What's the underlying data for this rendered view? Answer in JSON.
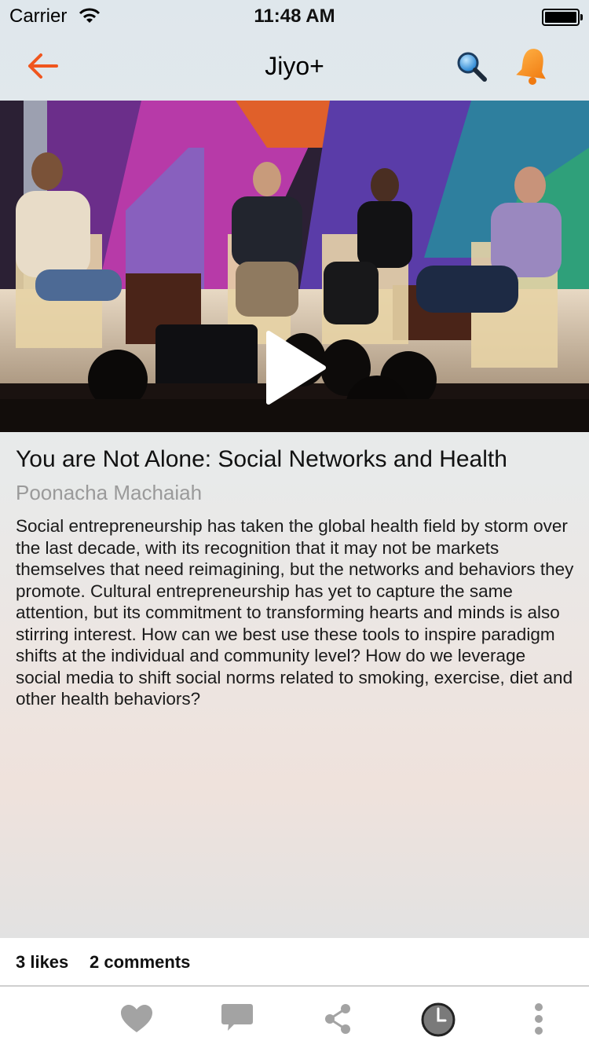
{
  "status_bar": {
    "carrier": "Carrier",
    "time": "11:48 AM"
  },
  "nav": {
    "title": "Jiyo+",
    "accent_color": "#f0561e"
  },
  "video": {
    "has_play_button": true
  },
  "article": {
    "title": "You are Not Alone: Social Networks and Health",
    "author": "Poonacha Machaiah",
    "description": "Social entrepreneurship has taken the global health field by storm over the last decade, with its recognition that it may not be markets themselves that need reimagining, but the networks and behaviors they promote. Cultural entrepreneurship has yet to capture the same attention, but its commitment to transforming hearts and minds is also stirring interest. How can we best use these tools to inspire paradigm shifts at the individual and community level? How do we leverage social media to shift social norms related to smoking, exercise, diet and other health behaviors?"
  },
  "stats": {
    "likes": "3 likes",
    "comments": "2 comments"
  },
  "toolbar": {
    "icons": [
      "heart-icon",
      "comment-icon",
      "share-icon",
      "clock-icon",
      "more-icon"
    ]
  }
}
